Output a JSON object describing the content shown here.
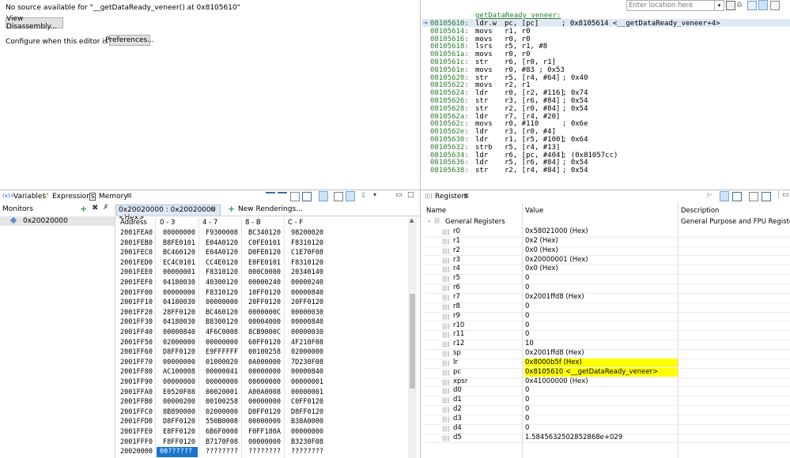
{
  "editor": {
    "message": "No source available for \"__getDataReady_veneer() at 0x8105610\"",
    "view_disassembly": "View Disassembly...",
    "configure_text": "Configure when this editor is shown",
    "preferences": "Preferences..."
  },
  "disassembly": {
    "location_placeholder": "Enter location here",
    "function_label": "getDataReady_veneer:",
    "lines": [
      {
        "addr": "08105610:",
        "mn": "ldr.w",
        "ops": "pc, [pc]",
        "cmt": "; 0x8105614 <__getDataReady_veneer+4>"
      },
      {
        "addr": "08105614:",
        "mn": "movs",
        "ops": "r1, r0",
        "cmt": ""
      },
      {
        "addr": "08105616:",
        "mn": "movs",
        "ops": "r0, r0",
        "cmt": ""
      },
      {
        "addr": "08105618:",
        "mn": "lsrs",
        "ops": "r5, r1, #8",
        "cmt": ""
      },
      {
        "addr": "0810561a:",
        "mn": "movs",
        "ops": "r0, r0",
        "cmt": ""
      },
      {
        "addr": "0810561c:",
        "mn": "str",
        "ops": "r6, [r0, r1]",
        "cmt": ""
      },
      {
        "addr": "0810561e:",
        "mn": "movs",
        "ops": "r0, #83 ; 0x53",
        "cmt": ""
      },
      {
        "addr": "08105620:",
        "mn": "str",
        "ops": "r5, [r4, #64]",
        "cmt": "; 0x40"
      },
      {
        "addr": "08105622:",
        "mn": "movs",
        "ops": "r2, r1",
        "cmt": ""
      },
      {
        "addr": "08105624:",
        "mn": "ldr",
        "ops": "r0, [r2, #116]",
        "cmt": "; 0x74"
      },
      {
        "addr": "08105626:",
        "mn": "str",
        "ops": "r3, [r6, #84]",
        "cmt": "; 0x54"
      },
      {
        "addr": "08105628:",
        "mn": "str",
        "ops": "r2, [r0, #84]",
        "cmt": "; 0x54"
      },
      {
        "addr": "0810562a:",
        "mn": "ldr",
        "ops": "r7, [r4, #20]",
        "cmt": ""
      },
      {
        "addr": "0810562c:",
        "mn": "movs",
        "ops": "r0, #110",
        "cmt": "; 0x6e"
      },
      {
        "addr": "0810562e:",
        "mn": "ldr",
        "ops": "r3, [r0, #4]",
        "cmt": ""
      },
      {
        "addr": "08105630:",
        "mn": "ldr",
        "ops": "r1, [r5, #100]",
        "cmt": "; 0x64"
      },
      {
        "addr": "08105632:",
        "mn": "strb",
        "ops": "r5, [r4, #13]",
        "cmt": ""
      },
      {
        "addr": "08105634:",
        "mn": "ldr",
        "ops": "r6, [pc, #404]",
        "cmt": "; (0x81057cc)"
      },
      {
        "addr": "08105636:",
        "mn": "ldr",
        "ops": "r5, [r6, #84]",
        "cmt": "; 0x54"
      },
      {
        "addr": "08105638:",
        "mn": "str",
        "ops": "r2, [r4, #84]",
        "cmt": "; 0x54"
      }
    ]
  },
  "tabs": {
    "variables": "Variables",
    "expressions": "Expressions",
    "memory": "Memory",
    "registers": "Registers"
  },
  "monitors": {
    "title": "Monitors",
    "item": "0x20020000"
  },
  "memory": {
    "tab_label": "0x20020000 : 0x20020000 <Hex>",
    "new_renderings": "New Renderings...",
    "headers": [
      "Address",
      "0 - 3",
      "4 - 7",
      "8 - B",
      "C - F"
    ],
    "rows": [
      [
        "2001FEA0",
        "00000000",
        "F9300008",
        "BC340120",
        "98200020"
      ],
      [
        "2001FEB0",
        "B8FE0101",
        "E04A0120",
        "C0FE0101",
        "F8310120"
      ],
      [
        "2001FEC0",
        "BC460120",
        "E04A0120",
        "D0FE0120",
        "C1E70F08"
      ],
      [
        "2001FED0",
        "EC4C0101",
        "CC4E0120",
        "E0FE0101",
        "F8310120"
      ],
      [
        "2001FEE0",
        "00000001",
        "F8310120",
        "000C0000",
        "20340140"
      ],
      [
        "2001FEF0",
        "04180030",
        "40300120",
        "00000240",
        "00000240"
      ],
      [
        "2001FF00",
        "00000000",
        "F8310120",
        "10FF0120",
        "00000840"
      ],
      [
        "2001FF10",
        "04180030",
        "00000000",
        "20FF0120",
        "20FF0120"
      ],
      [
        "2001FF20",
        "28FF0120",
        "BC460120",
        "0000000C",
        "00000030"
      ],
      [
        "2001FF30",
        "04180030",
        "B8300120",
        "00004000",
        "00000840"
      ],
      [
        "2001FF40",
        "00000840",
        "4F6C0008",
        "8CB9000C",
        "00000030"
      ],
      [
        "2001FF50",
        "02000000",
        "00000000",
        "60FF0120",
        "4F210F08"
      ],
      [
        "2001FF60",
        "D8FF0120",
        "E9FFFFFF",
        "00100258",
        "02000000"
      ],
      [
        "2001FF70",
        "00000000",
        "01000020",
        "0A000000",
        "7D230F08"
      ],
      [
        "2001FF80",
        "AC100008",
        "00000041",
        "00000000",
        "00000840"
      ],
      [
        "2001FF90",
        "00000000",
        "00000000",
        "00000000",
        "00000001"
      ],
      [
        "2001FFA0",
        "E0520F08",
        "00020001",
        "A00A0008",
        "00000001"
      ],
      [
        "2001FFB0",
        "00000200",
        "00100258",
        "00000000",
        "C0FF0120"
      ],
      [
        "2001FFC0",
        "8B890000",
        "02000000",
        "D0FF0120",
        "D8FF0120"
      ],
      [
        "2001FFD0",
        "D8FF0120",
        "550B0008",
        "00000000",
        "B38A0000"
      ],
      [
        "2001FFE0",
        "E8FF0120",
        "6B6F0008",
        "F0FF180A",
        "00000000"
      ],
      [
        "2001FFF0",
        "F8FF0120",
        "B7170F08",
        "00000000",
        "B3230F08"
      ],
      [
        "20020000",
        "00??????",
        "????????",
        "????????",
        "????????"
      ]
    ],
    "selected_cell": "00??????"
  },
  "registers": {
    "headers": [
      "Name",
      "Value",
      "Description"
    ],
    "group": {
      "name": "General Registers",
      "description": "General Purpose and FPU Register Group"
    },
    "items": [
      {
        "name": "r0",
        "value": "0x58021000 (Hex)",
        "hl": false
      },
      {
        "name": "r1",
        "value": "0x2 (Hex)",
        "hl": false
      },
      {
        "name": "r2",
        "value": "0x0 (Hex)",
        "hl": false
      },
      {
        "name": "r3",
        "value": "0x20000001 (Hex)",
        "hl": false
      },
      {
        "name": "r4",
        "value": "0x0 (Hex)",
        "hl": false
      },
      {
        "name": "r5",
        "value": "0",
        "hl": false
      },
      {
        "name": "r6",
        "value": "0",
        "hl": false
      },
      {
        "name": "r7",
        "value": "0x2001ffd8 (Hex)",
        "hl": false
      },
      {
        "name": "r8",
        "value": "0",
        "hl": false
      },
      {
        "name": "r9",
        "value": "0",
        "hl": false
      },
      {
        "name": "r10",
        "value": "0",
        "hl": false
      },
      {
        "name": "r11",
        "value": "0",
        "hl": false
      },
      {
        "name": "r12",
        "value": "10",
        "hl": false
      },
      {
        "name": "sp",
        "value": "0x2001ffd8 (Hex)",
        "hl": false
      },
      {
        "name": "lr",
        "value": "0x8000b5f (Hex)",
        "hl": true
      },
      {
        "name": "pc",
        "value": "0x8105610 <__getDataReady_veneer>",
        "hl": true
      },
      {
        "name": "xpsr",
        "value": "0x41000000 (Hex)",
        "hl": false
      },
      {
        "name": "d0",
        "value": "0",
        "hl": false
      },
      {
        "name": "d1",
        "value": "0",
        "hl": false
      },
      {
        "name": "d2",
        "value": "0",
        "hl": false
      },
      {
        "name": "d3",
        "value": "0",
        "hl": false
      },
      {
        "name": "d4",
        "value": "0",
        "hl": false
      },
      {
        "name": "d5",
        "value": "1.5845632502852868e+029",
        "hl": false
      }
    ]
  },
  "colors": {
    "highlight": "#ffff00",
    "selection": "#1874cd",
    "disasm_address": "#2d7d2d",
    "current_line": "#dfe9f5"
  }
}
